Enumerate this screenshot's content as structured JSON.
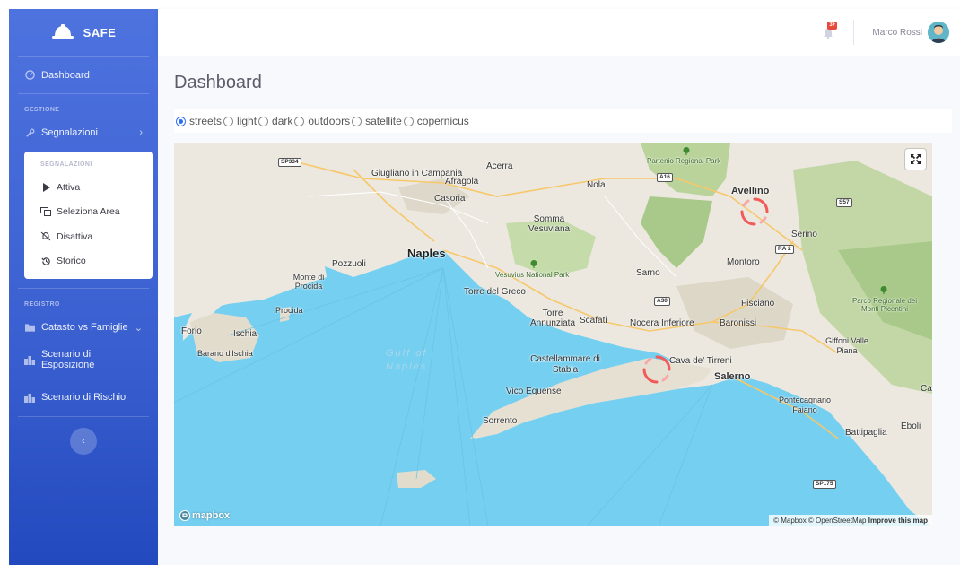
{
  "brand": {
    "name": "SAFE"
  },
  "sidebar": {
    "dashboard": "Dashboard",
    "section_gestione": "GESTIONE",
    "segnalazioni": "Segnalazioni",
    "submenu": {
      "header": "SEGNALAZIONI",
      "items": [
        {
          "label": "Attiva",
          "icon": "play-icon"
        },
        {
          "label": "Seleziona Area",
          "icon": "select-area-icon"
        },
        {
          "label": "Disattiva",
          "icon": "bell-slash-icon"
        },
        {
          "label": "Storico",
          "icon": "history-icon"
        }
      ]
    },
    "section_registro": "REGISTRO",
    "catasto": "Catasto vs Famiglie",
    "scenario_esposizione": "Scenario di Esposizione",
    "scenario_rischio": "Scenario di Rischio"
  },
  "topbar": {
    "notification_badge": "3+",
    "user_name": "Marco Rossi"
  },
  "main": {
    "title": "Dashboard",
    "map_styles": [
      {
        "label": "streets",
        "checked": true
      },
      {
        "label": "light",
        "checked": false
      },
      {
        "label": "dark",
        "checked": false
      },
      {
        "label": "outdoors",
        "checked": false
      },
      {
        "label": "satellite",
        "checked": false
      },
      {
        "label": "copernicus",
        "checked": false
      }
    ]
  },
  "map": {
    "labels": {
      "giugliano": "Giugliano in Campania",
      "afragola": "Afragola",
      "acerra": "Acerra",
      "casoria": "Casoria",
      "nola": "Nola",
      "somma": "Somma Vesuviana",
      "naples": "Naples",
      "pozzuoli": "Pozzuoli",
      "monte_di_procida": "Monte di Procida",
      "procida": "Procida",
      "forio": "Forio",
      "ischia": "Ischia",
      "barano": "Barano d'Ischia",
      "vesuvius": "Vesuvius National Park",
      "torre_greco": "Torre del Greco",
      "torre_annunziata": "Torre Annunziata",
      "scafati": "Scafati",
      "nocera": "Nocera Inferiore",
      "baronissi": "Baronissi",
      "sarno": "Sarno",
      "montoro": "Montoro",
      "fisciano": "Fisciano",
      "avellino": "Avellino",
      "serino": "Serino",
      "partenio": "Partenio Regional Park",
      "picentini": "Parco Regionale dei Monti Picentini",
      "gulf": "Gulf of Naples",
      "castellammare": "Castellammare di Stabia",
      "vico": "Vico Equense",
      "sorrento": "Sorrento",
      "cava": "Cava de' Tirreni",
      "salerno": "Salerno",
      "giffoni": "Giffoni Valle Piana",
      "pontecagnano": "Pontecagnano Faiano",
      "battipaglia": "Battipaglia",
      "eboli": "Eboli",
      "ca": "Ca"
    },
    "shields": {
      "sp334": "SP334",
      "a16": "A16",
      "s57": "S57",
      "ra2": "RA 2",
      "a30": "A30",
      "sp175": "SP175"
    },
    "logo_text": "mapbox",
    "attribution": "© Mapbox © OpenStreetMap",
    "improve": "Improve this map"
  }
}
